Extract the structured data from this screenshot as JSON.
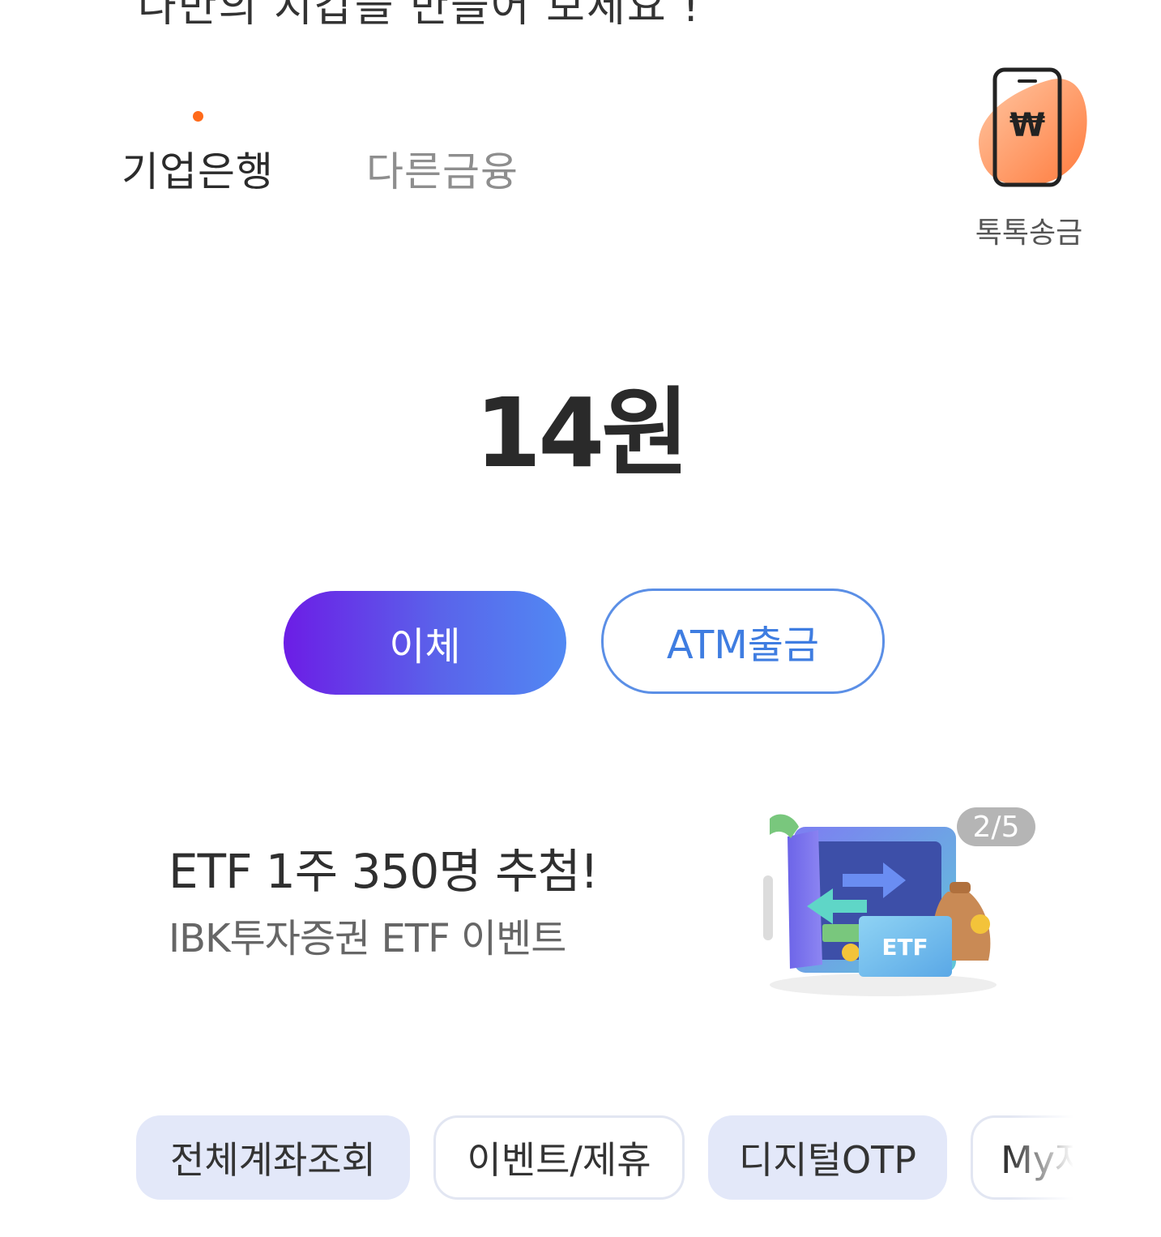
{
  "header": {
    "clipped_text": "나만의 지갑을 만들어 보세요 !"
  },
  "tabs": [
    {
      "label": "기업은행",
      "active": true
    },
    {
      "label": "다른금융",
      "active": false
    }
  ],
  "toktok": {
    "label": "톡톡송금",
    "icon": "phone-won-icon",
    "symbol": "₩"
  },
  "balance": {
    "amount": "14원"
  },
  "actions": {
    "transfer_label": "이체",
    "atm_label": "ATM출금"
  },
  "banner": {
    "title": "ETF 1주 350명 추첨!",
    "subtitle": "IBK투자증권 ETF 이벤트",
    "page_indicator": "2/5",
    "art_label": "ETF"
  },
  "chips": [
    {
      "label": "전체계좌조회"
    },
    {
      "label": "이벤트/제휴"
    },
    {
      "label": "디지털OTP"
    },
    {
      "label": "My자"
    }
  ],
  "colors": {
    "accent_orange": "#ff6a1a",
    "transfer_gradient_start": "#6c1de6",
    "transfer_gradient_end": "#5189f3",
    "atm_blue": "#3f7de1",
    "chip_fill": "#e3e8f9"
  }
}
